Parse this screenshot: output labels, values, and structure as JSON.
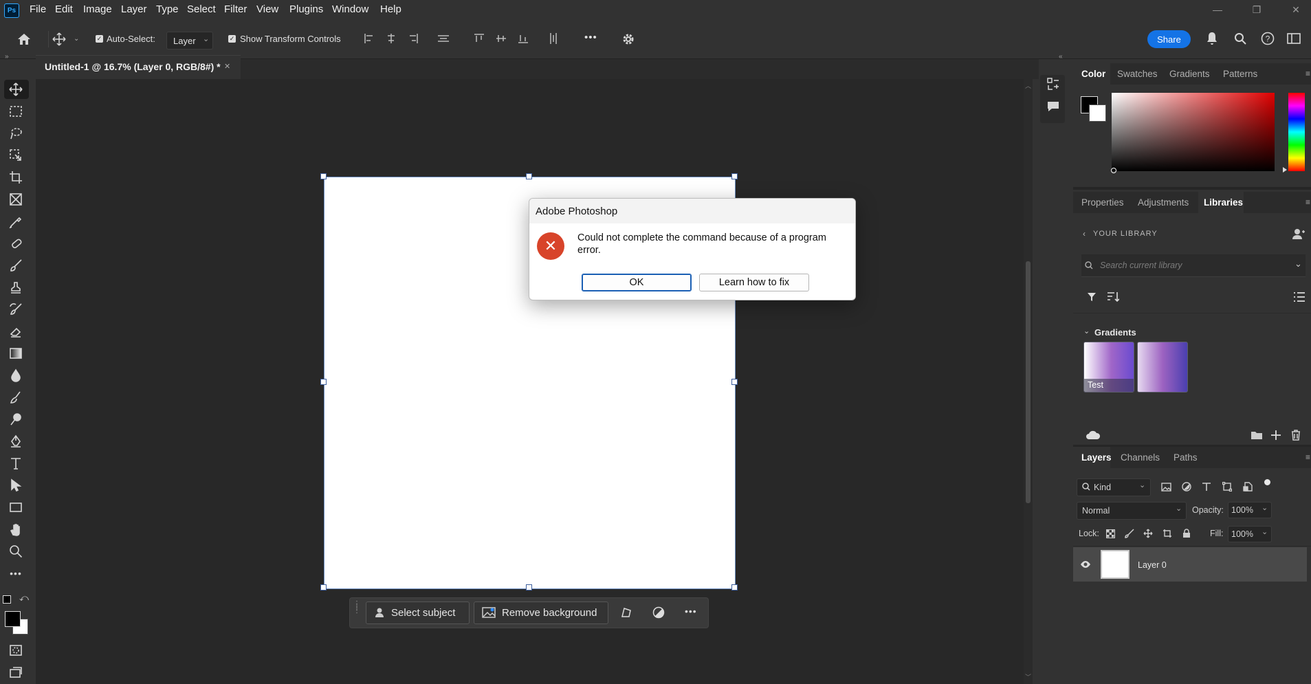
{
  "app": {
    "logo_text": "Ps"
  },
  "menu": [
    "File",
    "Edit",
    "Image",
    "Layer",
    "Type",
    "Select",
    "Filter",
    "View",
    "Plugins",
    "Window",
    "Help"
  ],
  "window_controls": {
    "minimize": "—",
    "restore": "❐",
    "close": "✕"
  },
  "options_bar": {
    "auto_select_label": "Auto-Select:",
    "auto_select_target": "Layer",
    "show_transform_label": "Show Transform Controls",
    "more_label": "•••",
    "share_label": "Share"
  },
  "document_tab": {
    "title": "Untitled-1 @ 16.7% (Layer 0, RGB/8#) *",
    "close": "✕"
  },
  "dialog": {
    "title": "Adobe Photoshop",
    "message": "Could not complete the command because of a program error.",
    "ok_label": "OK",
    "learn_label": "Learn how to fix"
  },
  "context_bar": {
    "select_subject": "Select subject",
    "remove_background": "Remove background",
    "more": "•••"
  },
  "color_panel": {
    "tabs": [
      "Color",
      "Swatches",
      "Gradients",
      "Patterns"
    ],
    "active_tab": "Color",
    "foreground": "#000000",
    "background": "#ffffff"
  },
  "libraries_panel": {
    "tabs": [
      "Properties",
      "Adjustments",
      "Libraries"
    ],
    "active_tab": "Libraries",
    "back_label": "YOUR LIBRARY",
    "search_placeholder": "Search current library",
    "section": "Gradients",
    "items": [
      {
        "label": "Test"
      },
      {
        "label": ""
      }
    ]
  },
  "layers_panel": {
    "tabs": [
      "Layers",
      "Channels",
      "Paths"
    ],
    "active_tab": "Layers",
    "kind_label": "Kind",
    "blend_mode": "Normal",
    "opacity_label": "Opacity:",
    "opacity_value": "100%",
    "lock_label": "Lock:",
    "fill_label": "Fill:",
    "fill_value": "100%",
    "layers": [
      {
        "name": "Layer 0",
        "visible": true
      }
    ]
  }
}
